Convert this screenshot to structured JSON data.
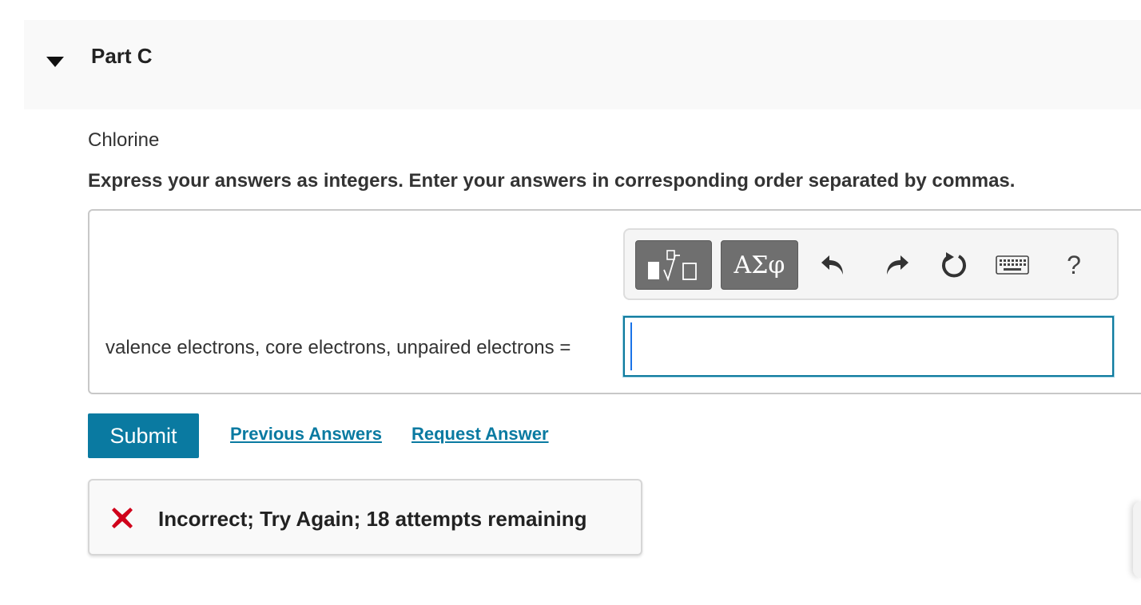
{
  "part": {
    "title": "Part C"
  },
  "question": {
    "element": "Chlorine",
    "instructions": "Express your answers as integers. Enter your answers in corresponding order separated by commas."
  },
  "toolbar": {
    "greek_label": "ΑΣφ",
    "help_label": "?",
    "icons": [
      "templates-icon",
      "undo-icon",
      "redo-icon",
      "reset-icon",
      "keyboard-icon",
      "help-icon"
    ]
  },
  "answer": {
    "label": "valence electrons, core electrons, unpaired electrons =",
    "value": "",
    "placeholder": ""
  },
  "actions": {
    "submit_label": "Submit",
    "previous_answers_label": "Previous Answers",
    "request_answer_label": "Request Answer"
  },
  "feedback": {
    "message": "Incorrect; Try Again; 18 attempts remaining",
    "status_color": "#d0021b"
  },
  "colors": {
    "accent": "#0a7aa1",
    "toolbar_button": "#6f6f6f",
    "input_focus": "#0e7a9e"
  }
}
